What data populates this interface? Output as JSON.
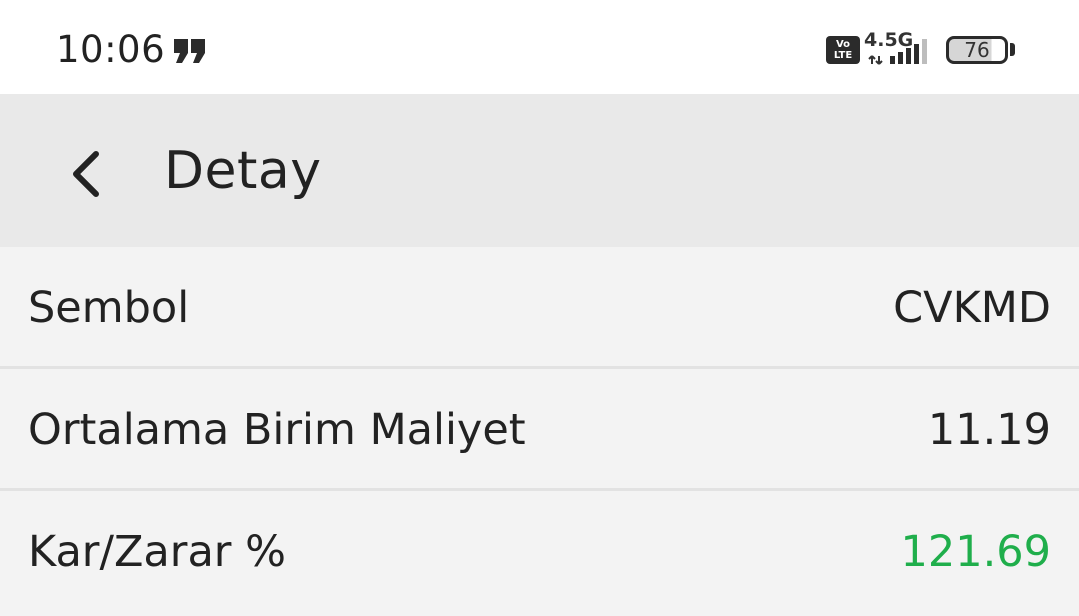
{
  "status_bar": {
    "time": "10:06",
    "notification_icon": "quote-notification-icon",
    "volte_label": "Vo LTE",
    "network_type": "4.5G",
    "signal_icon": "signal-bars-icon",
    "battery_level": "76"
  },
  "app_bar": {
    "back_icon": "chevron-left-icon",
    "title": "Detay"
  },
  "details": {
    "rows": [
      {
        "label": "Sembol",
        "value": "CVKMD",
        "value_color": "#222222"
      },
      {
        "label": "Ortalama Birim Maliyet",
        "value": "11.19",
        "value_color": "#222222"
      },
      {
        "label": "Kar/Zarar %",
        "value": "121.69",
        "value_color": "#1fae4b"
      }
    ]
  },
  "colors": {
    "status_bar_bg": "#ffffff",
    "app_bar_bg": "#e9e9e9",
    "content_bg": "#f3f3f3",
    "divider": "#e2e2e2",
    "profit_green": "#1fae4b"
  }
}
